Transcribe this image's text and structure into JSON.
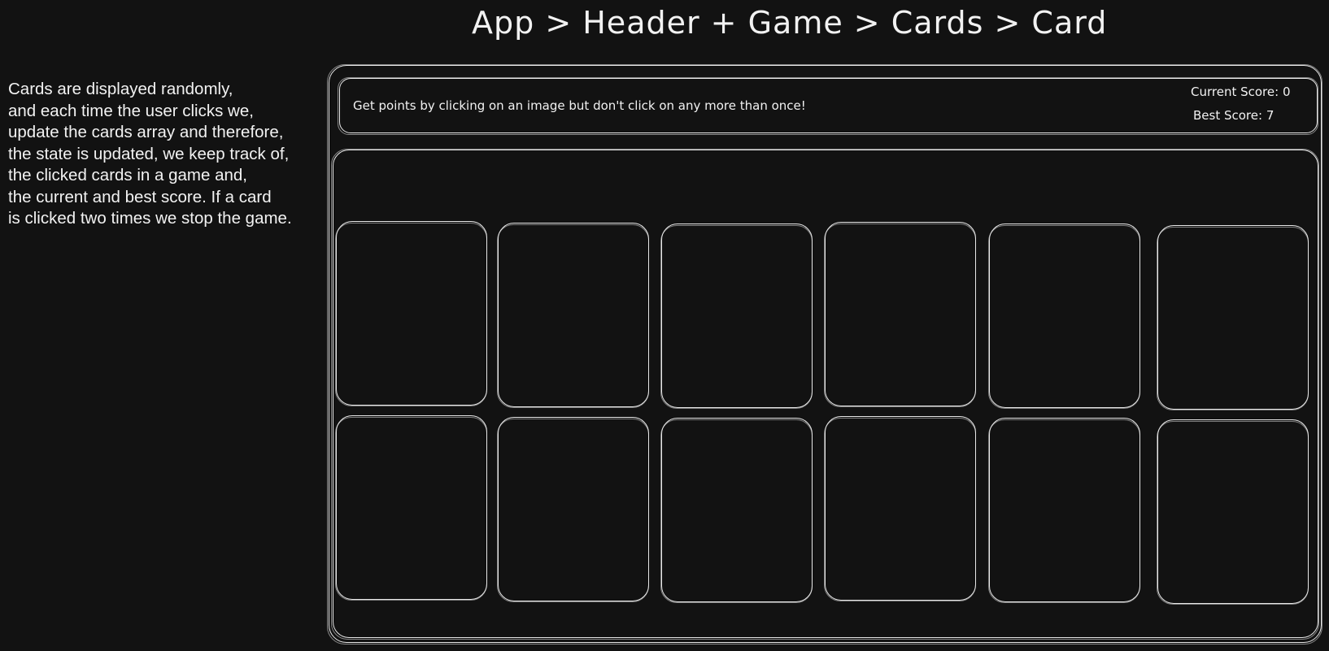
{
  "title": "App > Header + Game > Cards > Card",
  "description": [
    "Cards are displayed randomly,",
    "and each time the user clicks we,",
    "update the cards array and therefore,",
    "the state is updated, we keep track of,",
    "the clicked cards in a game and,",
    "the current and best score. If a card",
    "is clicked two times we stop the game."
  ],
  "header": {
    "instruction": "Get points by clicking on an image but don't click on any more than once!",
    "current_score": "Current Score: 0",
    "best_score": "Best Score: 7"
  },
  "game": {
    "card_count": 12
  }
}
